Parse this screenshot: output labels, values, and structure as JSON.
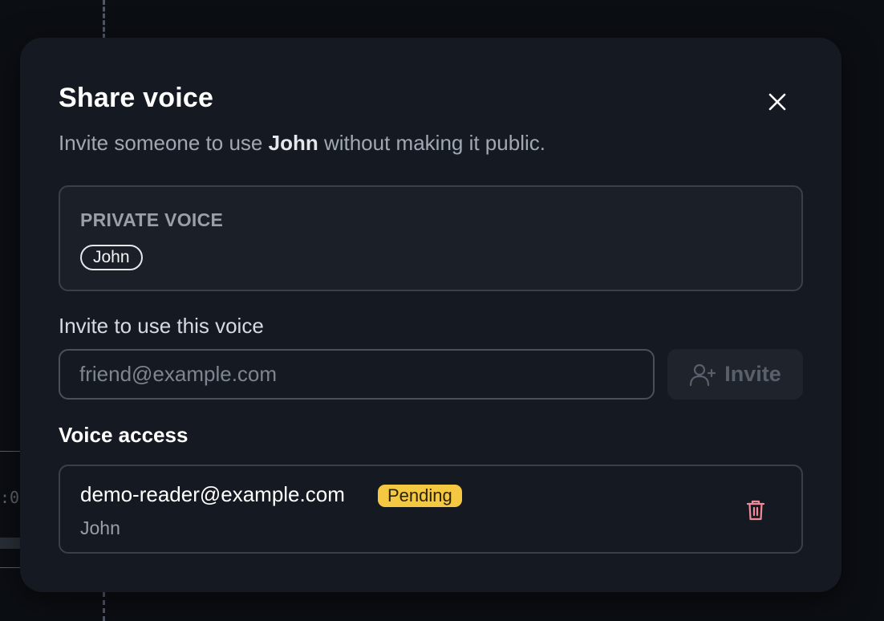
{
  "dialog": {
    "title": "Share voice",
    "subtitle_prefix": "Invite someone to use ",
    "subtitle_voice": "John",
    "subtitle_suffix": " without making it public."
  },
  "private_voice": {
    "label": "PRIVATE VOICE",
    "voice_name": "John"
  },
  "invite": {
    "label": "Invite to use this voice",
    "placeholder": "friend@example.com",
    "value": "",
    "button_label": "Invite",
    "button_icon": "user-plus-icon"
  },
  "access": {
    "heading": "Voice access",
    "entries": [
      {
        "email": "demo-reader@example.com",
        "status": "Pending",
        "voice": "John",
        "delete_icon": "trash-icon"
      }
    ]
  },
  "background": {
    "glyph": ":0"
  },
  "colors": {
    "modal_bg": "#151a22",
    "badge_pending": "#f5c842",
    "delete_icon": "#f08a96"
  }
}
